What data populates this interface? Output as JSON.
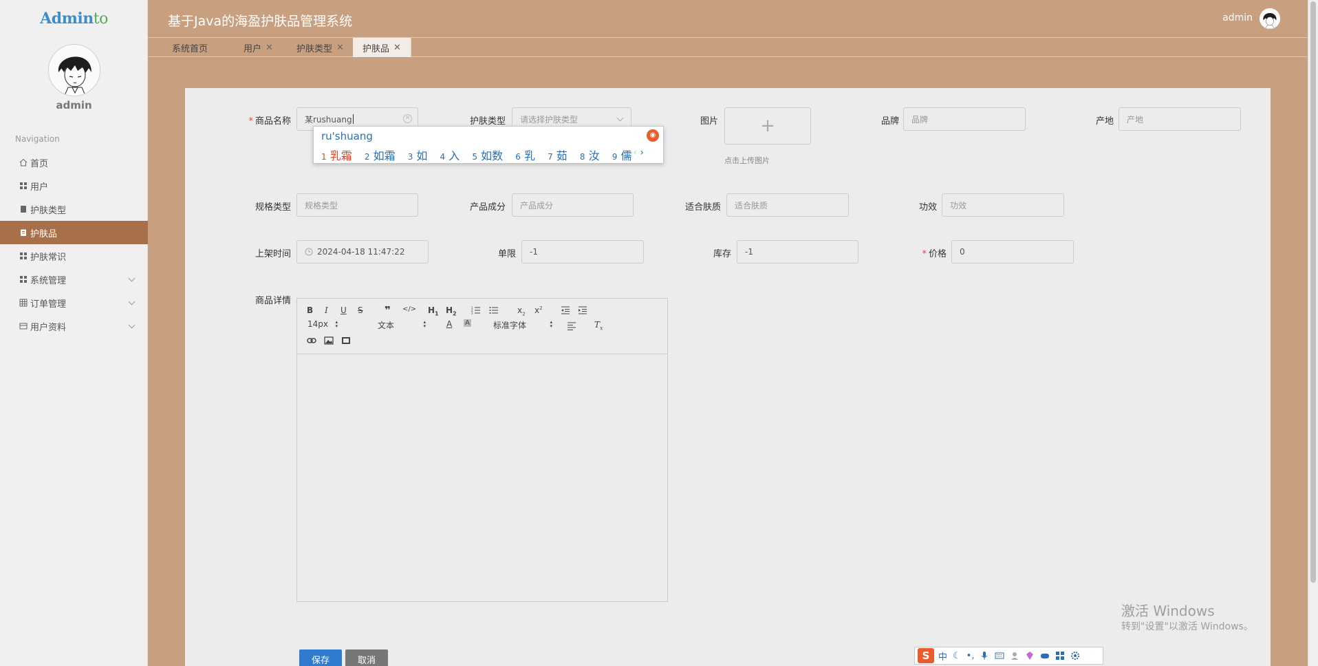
{
  "sidebar": {
    "logo_main": "Admin",
    "logo_accent": "to",
    "username": "admin",
    "nav_header": "Navigation",
    "items": [
      {
        "label": "首页",
        "icon": "home-icon"
      },
      {
        "label": "用户",
        "icon": "grid-icon"
      },
      {
        "label": "护肤类型",
        "icon": "book-icon"
      },
      {
        "label": "护肤品",
        "icon": "clipboard-icon",
        "active": true
      },
      {
        "label": "护肤常识",
        "icon": "grid-icon"
      },
      {
        "label": "系统管理",
        "icon": "grid-icon",
        "expandable": true
      },
      {
        "label": "订单管理",
        "icon": "table-icon",
        "expandable": true
      },
      {
        "label": "用户资料",
        "icon": "folder-icon",
        "expandable": true
      }
    ]
  },
  "header": {
    "title": "基于Java的海盈护肤品管理系统",
    "user": "admin"
  },
  "tabs": [
    {
      "label": "系统首页",
      "closable": false
    },
    {
      "label": "用户",
      "closable": true
    },
    {
      "label": "护肤类型",
      "closable": true
    },
    {
      "label": "护肤品",
      "closable": true,
      "active": true
    }
  ],
  "form": {
    "name_label": "商品名称",
    "name_value": "某rushuang",
    "type_label": "护肤类型",
    "type_placeholder": "请选择护肤类型",
    "image_label": "图片",
    "image_hint": "点击上传图片",
    "brand_label": "品牌",
    "brand_placeholder": "品牌",
    "origin_label": "产地",
    "origin_placeholder": "产地",
    "spec_label": "规格类型",
    "spec_placeholder": "规格类型",
    "ingredient_label": "产品成分",
    "ingredient_placeholder": "产品成分",
    "skin_label": "适合肤质",
    "skin_placeholder": "适合肤质",
    "effect_label": "功效",
    "effect_placeholder": "功效",
    "shelf_label": "上架时间",
    "shelf_value": "2024-04-18 11:47:22",
    "limit_label": "单限",
    "limit_value": "-1",
    "stock_label": "库存",
    "stock_value": "-1",
    "price_label": "价格",
    "price_value": "0",
    "detail_label": "商品详情",
    "save": "保存",
    "cancel": "取消"
  },
  "editor": {
    "size": "14px",
    "format": "文本",
    "font": "标准字体"
  },
  "ime": {
    "input": "ru'shuang",
    "candidates": [
      {
        "n": "1",
        "w": "乳霜"
      },
      {
        "n": "2",
        "w": "如霜"
      },
      {
        "n": "3",
        "w": "如"
      },
      {
        "n": "4",
        "w": "入"
      },
      {
        "n": "5",
        "w": "如数"
      },
      {
        "n": "6",
        "w": "乳"
      },
      {
        "n": "7",
        "w": "茹"
      },
      {
        "n": "8",
        "w": "汝"
      },
      {
        "n": "9",
        "w": "儒"
      }
    ],
    "bar_mode": "中"
  },
  "watermark": {
    "line1": "激活 Windows",
    "line2": "转到\"设置\"以激活 Windows。"
  }
}
